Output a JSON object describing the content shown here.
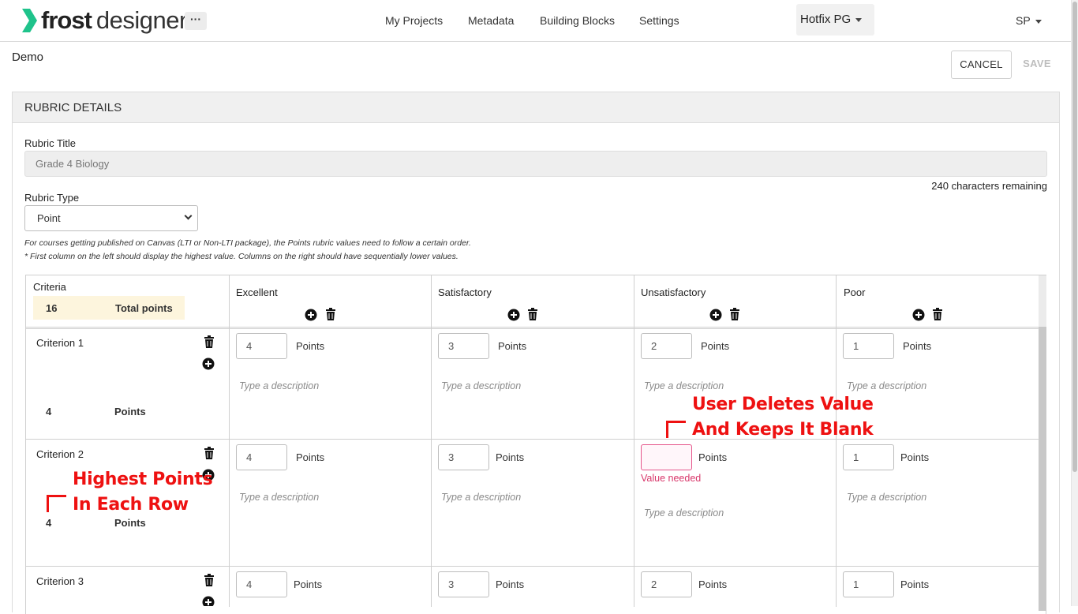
{
  "header": {
    "logo_text_bold": "frost",
    "logo_text": "designer",
    "more_label": "···",
    "nav": [
      "My Projects",
      "Metadata",
      "Building Blocks",
      "Settings"
    ],
    "environment": "Hotfix PG",
    "user": "SP"
  },
  "page": {
    "breadcrumb": "Demo",
    "cancel_label": "CANCEL",
    "save_label": "SAVE"
  },
  "rubric": {
    "section_title": "RUBRIC DETAILS",
    "title_label": "Rubric Title",
    "title_value": "Grade 4 Biology",
    "chars_remaining": "240 characters remaining",
    "type_label": "Rubric Type",
    "type_value": "Point",
    "note_line1": "For courses getting published on Canvas (LTI or Non-LTI package), the Points rubric values need to follow a certain order.",
    "note_line2": "* First column on the left should display the highest value. Columns on the right should have sequentially lower values."
  },
  "grid": {
    "criteria_header": "Criteria",
    "total_value": "16",
    "total_label": "Total points",
    "columns": [
      "Excellent",
      "Satisfactory",
      "Unsatisfactory",
      "Poor"
    ],
    "points_label": "Points",
    "desc_placeholder": "Type a description",
    "value_needed": "Value needed",
    "rows": [
      {
        "name": "Criterion 1",
        "points": "4",
        "values": [
          "4",
          "3",
          "2",
          "1"
        ]
      },
      {
        "name": "Criterion 2",
        "points": "4",
        "values": [
          "4",
          "3",
          "",
          "1"
        ]
      },
      {
        "name": "Criterion 3",
        "points": "",
        "values": [
          "4",
          "3",
          "2",
          "1"
        ]
      }
    ]
  },
  "annotations": {
    "deletes_line1": "User Deletes Value",
    "deletes_line2": "And Keeps It Blank",
    "highest_line1": "Highest Points",
    "highest_line2": "In Each Row"
  },
  "colors": {
    "brand_green": "#1fc38b",
    "annotation_red": "#ee1111",
    "error_pink": "#e5548a",
    "total_bg": "#fdf5dd"
  }
}
